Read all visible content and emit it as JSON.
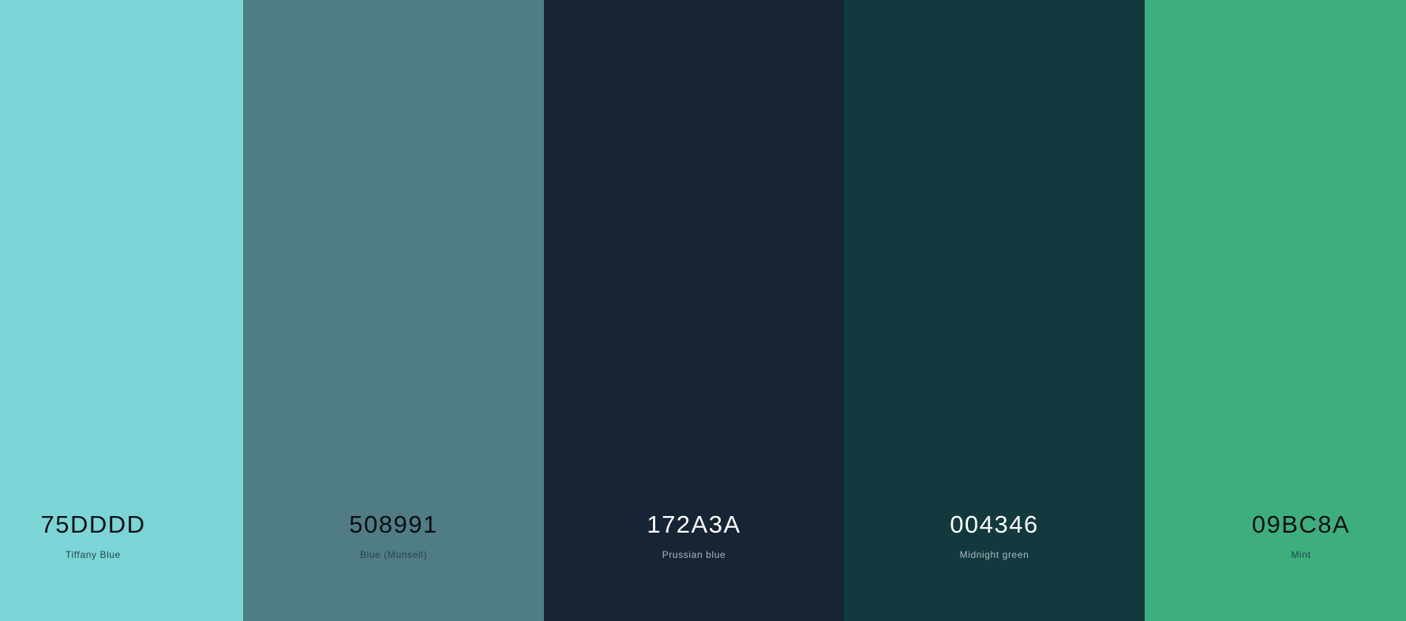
{
  "palette": {
    "swatches": [
      {
        "hex": "75DDDD",
        "name": "Tiffany Blue",
        "color": "#7bd5d7",
        "text_theme": "dark"
      },
      {
        "hex": "508991",
        "name": "Blue (Munsell)",
        "color": "#507c85",
        "text_theme": "dark"
      },
      {
        "hex": "172A3A",
        "name": "Prussian blue",
        "color": "#172433",
        "text_theme": "light"
      },
      {
        "hex": "004346",
        "name": "Midnight green",
        "color": "#12393d",
        "text_theme": "light"
      },
      {
        "hex": "09BC8A",
        "name": "Mint",
        "color": "#3daf7f",
        "text_theme": "dark"
      }
    ]
  }
}
